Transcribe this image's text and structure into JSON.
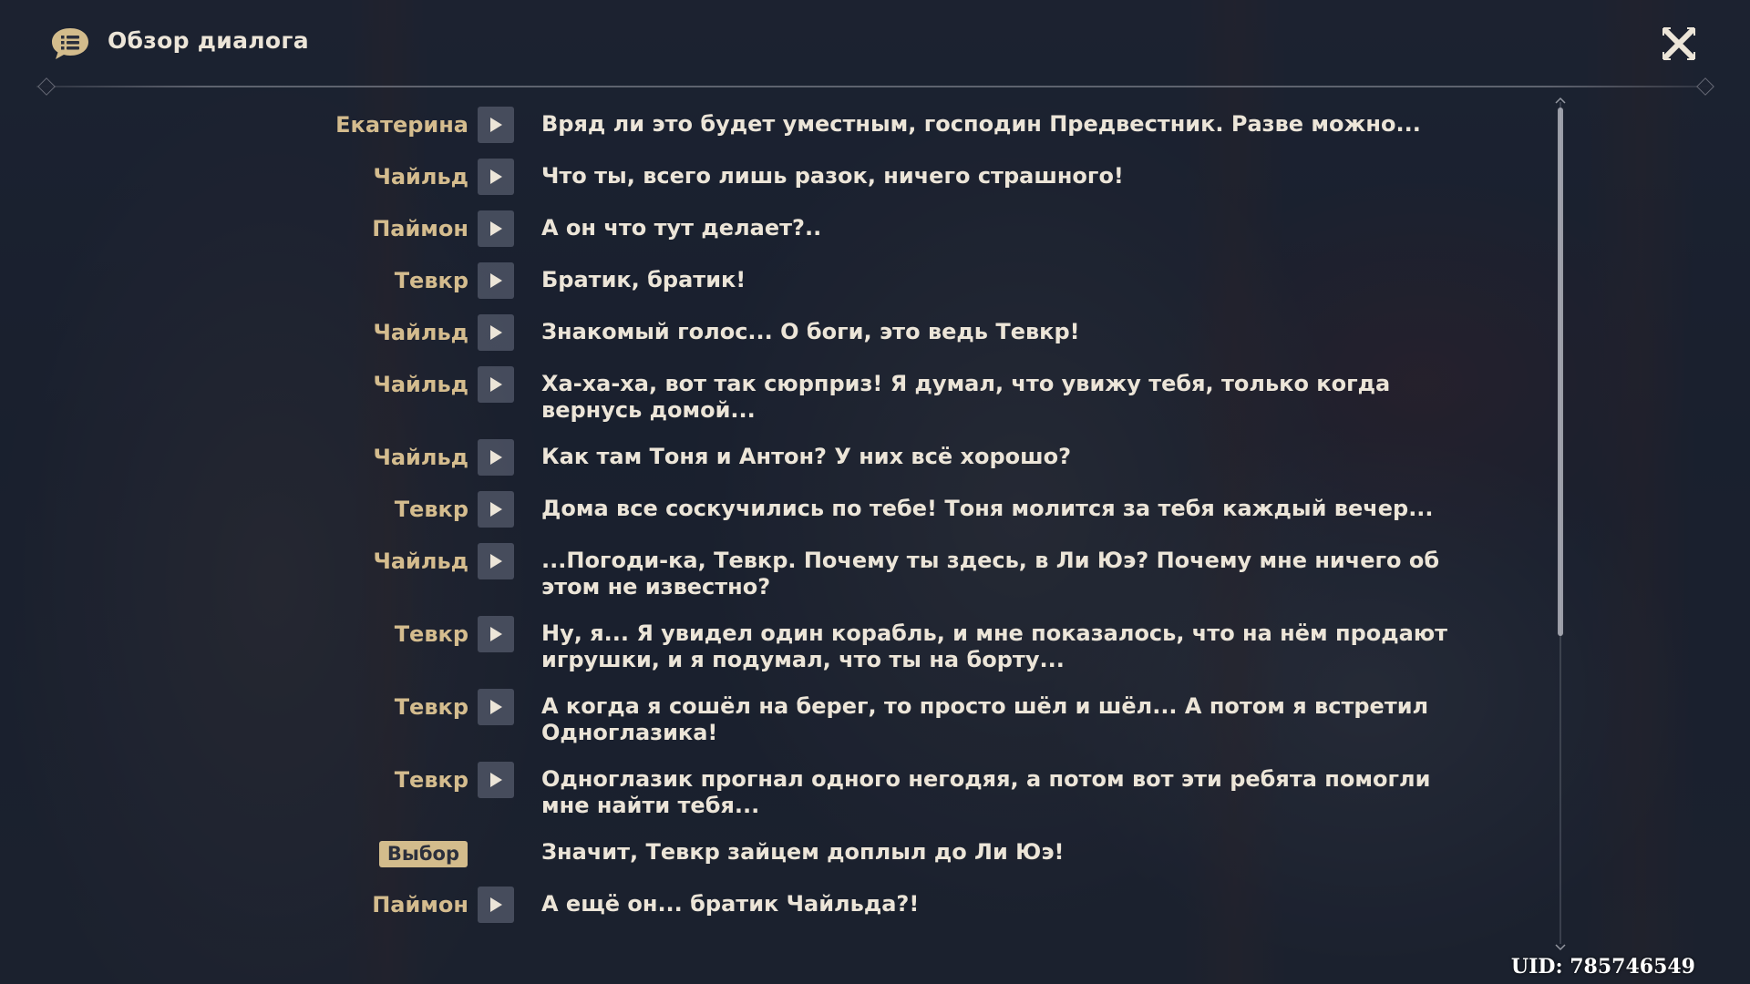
{
  "header": {
    "title": "Обзор диалога",
    "icon": "dialogue-list-icon",
    "close_icon": "close-icon"
  },
  "dialogue": [
    {
      "speaker": "Екатерина",
      "type": "voice",
      "text": "Вряд ли это будет уместным, господин Предвестник. Разве можно..."
    },
    {
      "speaker": "Чайльд",
      "type": "voice",
      "text": "Что ты, всего лишь разок, ничего страшного!"
    },
    {
      "speaker": "Паймон",
      "type": "voice",
      "text": "А он что тут делает?.."
    },
    {
      "speaker": "Тевкр",
      "type": "voice",
      "text": "Братик, братик!"
    },
    {
      "speaker": "Чайльд",
      "type": "voice",
      "text": "Знакомый голос... О боги, это ведь Тевкр!"
    },
    {
      "speaker": "Чайльд",
      "type": "voice",
      "text": "Ха-ха-ха, вот так сюрприз! Я думал, что увижу тебя, только когда вернусь домой..."
    },
    {
      "speaker": "Чайльд",
      "type": "voice",
      "text": "Как там Тоня и Антон? У них всё хорошо?"
    },
    {
      "speaker": "Тевкр",
      "type": "voice",
      "text": "Дома все соскучились по тебе! Тоня молится за тебя каждый вечер..."
    },
    {
      "speaker": "Чайльд",
      "type": "voice",
      "text": "...Погоди-ка, Тевкр. Почему ты здесь, в Ли Юэ? Почему мне ничего об этом не известно?"
    },
    {
      "speaker": "Тевкр",
      "type": "voice",
      "text": "Ну, я... Я увидел один корабль, и мне показалось, что на нём продают игрушки, и я подумал, что ты на борту..."
    },
    {
      "speaker": "Тевкр",
      "type": "voice",
      "text": "А когда я сошёл на берег, то просто шёл и шёл... А потом я встретил Одноглазика!"
    },
    {
      "speaker": "Тевкр",
      "type": "voice",
      "text": "Одноглазик прогнал одного негодяя, а потом вот эти ребята помогли мне найти тебя..."
    },
    {
      "speaker": "Выбор",
      "type": "choice",
      "text": "Значит, Тевкр зайцем доплыл до Ли Юэ!"
    },
    {
      "speaker": "Паймон",
      "type": "voice",
      "text": "А ещё он... братик Чайльда?!"
    }
  ],
  "uid": "UID: 785746549",
  "colors": {
    "speaker": "#d4bc8e",
    "text": "#ece5d8",
    "choice_badge": "#d3bc8c",
    "play_button": "#4e5464"
  },
  "icons": {
    "play": "play-icon",
    "scroll_up": "scroll-up-arrow-icon",
    "scroll_down": "scroll-down-arrow-icon"
  }
}
